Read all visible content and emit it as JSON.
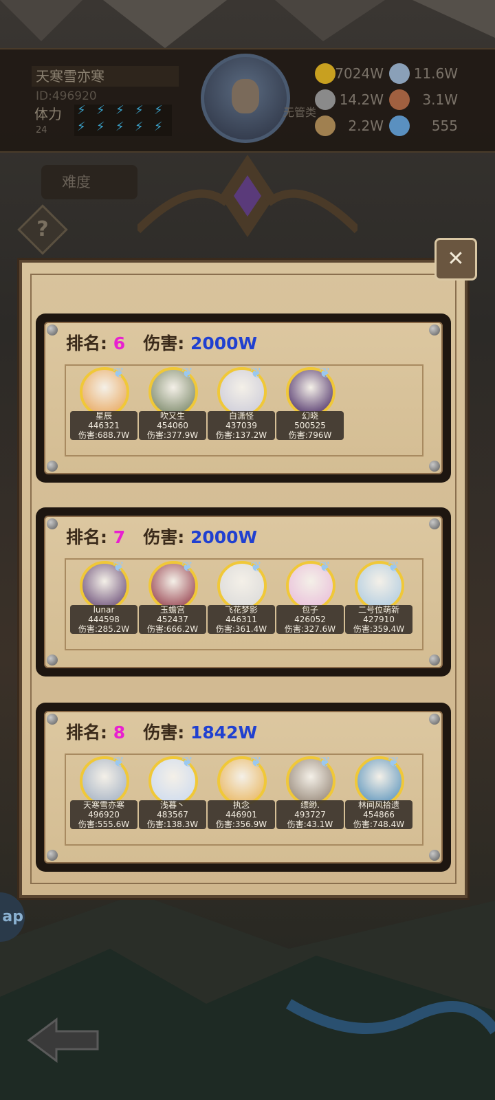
{
  "player": {
    "name": "天寒雪亦寒",
    "id_text": "ID:496920",
    "stamina_label": "体力",
    "stamina_value": "24",
    "title": "无管类"
  },
  "resources": [
    {
      "icon": "gold-coin-icon",
      "value": "7024W",
      "color": "#c8a020"
    },
    {
      "icon": "crystal-icon",
      "value": "11.6W",
      "color": "#8aa0b8"
    },
    {
      "icon": "ore-icon",
      "value": "14.2W",
      "color": "#8a8a8a"
    },
    {
      "icon": "beast-icon",
      "value": "3.1W",
      "color": "#a06040"
    },
    {
      "icon": "scroll-icon",
      "value": "2.2W",
      "color": "#a08050"
    },
    {
      "icon": "gem-icon",
      "value": "555",
      "color": "#5a90c0"
    }
  ],
  "difficulty_tab": "难度",
  "help_label": "?",
  "left_tab": "ap",
  "teams": [
    {
      "rank_label": "排名:",
      "rank": "6",
      "damage_label": "伤害:",
      "damage": "2000W",
      "members": [
        {
          "name": "星辰",
          "power": "446321",
          "damage": "伤害:688.7W",
          "color": "#e8a050"
        },
        {
          "name": "吹又生",
          "power": "454060",
          "damage": "伤害:377.9W",
          "color": "#6a7a58"
        },
        {
          "name": "白潇怪",
          "power": "437039",
          "damage": "伤害:137.2W",
          "color": "#c8c8d8"
        },
        {
          "name": "幻晓",
          "power": "500525",
          "damage": "伤害:796W",
          "color": "#3a1a5a"
        }
      ]
    },
    {
      "rank_label": "排名:",
      "rank": "7",
      "damage_label": "伤害:",
      "damage": "2000W",
      "members": [
        {
          "name": "lunar",
          "power": "444598",
          "damage": "伤害:285.2W",
          "color": "#5a3a6a"
        },
        {
          "name": "玉蟾宫",
          "power": "452437",
          "damage": "伤害:666.2W",
          "color": "#8a2a3a"
        },
        {
          "name": "飞花梦影",
          "power": "446311",
          "damage": "伤害:361.4W",
          "color": "#d8d8d8"
        },
        {
          "name": "包子",
          "power": "426052",
          "damage": "伤害:327.6W",
          "color": "#e8b8d8"
        },
        {
          "name": "二号位萌新",
          "power": "427910",
          "damage": "伤害:359.4W",
          "color": "#a8c8e0"
        }
      ]
    },
    {
      "rank_label": "排名:",
      "rank": "8",
      "damage_label": "伤害:",
      "damage": "1842W",
      "members": [
        {
          "name": "天寒雪亦寒",
          "power": "496920",
          "damage": "伤害:555.6W",
          "color": "#9aaac0"
        },
        {
          "name": "浅暮丶",
          "power": "483567",
          "damage": "伤害:138.3W",
          "color": "#c8d8f0"
        },
        {
          "name": "执念",
          "power": "446901",
          "damage": "伤害:356.9W",
          "color": "#e8b050"
        },
        {
          "name": "缥缈.",
          "power": "493727",
          "damage": "伤害:43.1W",
          "color": "#8a7a6a"
        },
        {
          "name": "林间风拾遗",
          "power": "454866",
          "damage": "伤害:748.4W",
          "color": "#4a8ab8"
        }
      ]
    }
  ]
}
